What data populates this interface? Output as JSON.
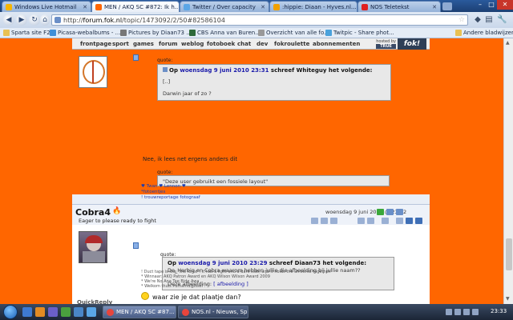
{
  "browser": {
    "tabs": [
      {
        "label": "Windows Live Hotmail",
        "color": "#f7b500"
      },
      {
        "label": "MEN / AKQ SC #872: Ik h...",
        "color": "#ff6600"
      },
      {
        "label": "Twitter / Over capacity",
        "color": "#5aa6e6"
      },
      {
        "label": ":hippie: Diaan - Hyves.nl...",
        "color": "#f0a000"
      },
      {
        "label": "NOS Teletekst",
        "color": "#e02020"
      }
    ],
    "url_prefix": "http://",
    "url_host": "forum.fok.nl",
    "url_path": "/topic/1473092/2/50#82586104",
    "bookmarks": [
      "Sparta site F2",
      "Picasa-webalbums - ...",
      "Pictures by Diaan73 ...",
      "CBS Anna van Buren...",
      "Overzicht van alle fo...",
      "Twitpic - Share phot..."
    ],
    "other_bookmarks": "Andere bladwijzers"
  },
  "site": {
    "nav": [
      "frontpage",
      "sport",
      "games",
      "forum",
      "weblog",
      "fotoboek",
      "chat",
      "dev",
      "fokroulette",
      "abonnementen"
    ],
    "hosted_by": "hosted by",
    "hosted_brand": "TRUE",
    "logo": "fok!"
  },
  "post1": {
    "quote1_label": "quote:",
    "quote1_prefix": "Op",
    "quote1_date": "woensdag 9 juni 2010 23:31",
    "quote1_author_line": "schreef Whiteguy het volgende:",
    "quote1_ellipsis": "[..]",
    "quote1_text": "Darwin jaar of zo ?",
    "body": "Nee, ik lees net ergens anders dit",
    "quote2_label": "quote:",
    "quote2_text": "\"Deze user gebruikt een fossiele layout\"",
    "sig_line1": "♥ Twan ♥ Lennon ♥",
    "sig_line2": "*fotoentjes",
    "sig_line3": "! trouwreportage fotograaf"
  },
  "post2": {
    "username": "Cobra4",
    "tagline": "Eager to please ready to fight",
    "date": "woensdag 9 juni 2010 @ 23:32",
    "quote_label": "quote:",
    "quote_prefix": "Op",
    "quote_date": "woensdag 9 juni 2010 23:29",
    "quote_author_line": "schreef Diaan73 het volgende:",
    "quote_line1": "De_Herbig en Cobra waarom hebben jullie die afbeelding bij jullie naam??",
    "quote_line2_prefix": "Deze afbeelding:",
    "quote_line2_link": "[ afbeelding ]",
    "reply": "waar zie je dat plaatje dan?",
    "sig": [
      "! Duct tape is like \"the force\": It has a light and a dark side, and it holds the universe together.",
      "* Winnaar: AKQ Patron Award en AKQ Wilson Wilson Award 2009",
      "* We're No Ana Tae Bide Awa",
      "* Welkom thuis Pumamdijpssel :*"
    ]
  },
  "quickreply": "QuickReply",
  "taskbar": {
    "buttons": [
      "MEN / AKQ SC #87...",
      "NOS.nl - Nieuws, Sp..."
    ],
    "clock": "23:33"
  }
}
